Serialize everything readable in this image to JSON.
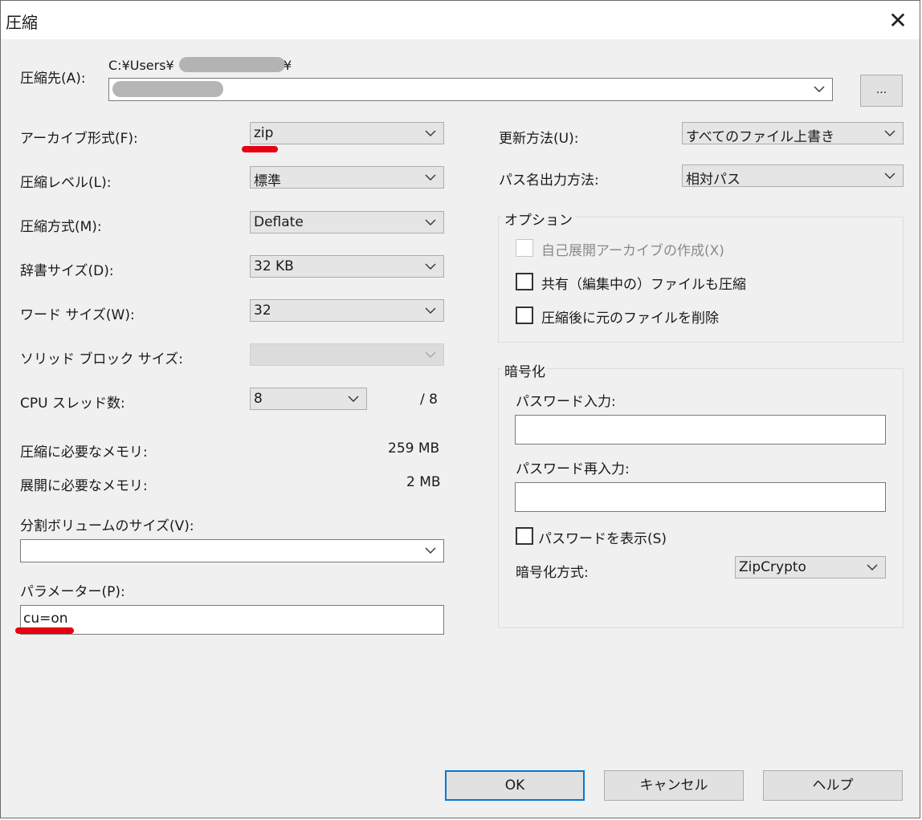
{
  "window": {
    "title": "圧縮",
    "close_glyph": "✕"
  },
  "destination": {
    "label": "圧縮先(A):",
    "path_prefix": "C:¥Users¥",
    "path_suffix": "¥",
    "browse_label": "..."
  },
  "left": {
    "archive_format": {
      "label": "アーカイブ形式(F):",
      "value": "zip"
    },
    "compression_level": {
      "label": "圧縮レベル(L):",
      "value": "標準"
    },
    "compression_method": {
      "label": "圧縮方式(M):",
      "value": "Deflate"
    },
    "dictionary_size": {
      "label": "辞書サイズ(D):",
      "value": "32 KB"
    },
    "word_size": {
      "label": "ワード サイズ(W):",
      "value": "32"
    },
    "solid_block_size": {
      "label": "ソリッド ブロック サイズ:",
      "value": ""
    },
    "cpu_threads": {
      "label": "CPU スレッド数:",
      "value": "8",
      "total": "/ 8"
    },
    "memory_compress": {
      "label": "圧縮に必要なメモリ:",
      "value": "259 MB"
    },
    "memory_decompress": {
      "label": "展開に必要なメモリ:",
      "value": "2 MB"
    },
    "split_volume": {
      "label": "分割ボリュームのサイズ(V):",
      "value": ""
    },
    "parameters": {
      "label": "パラメーター(P):",
      "value": "cu=on"
    }
  },
  "right": {
    "update_mode": {
      "label": "更新方法(U):",
      "value": "すべてのファイル上書き"
    },
    "path_mode": {
      "label": "パス名出力方法:",
      "value": "相対パス"
    },
    "options": {
      "title": "オプション",
      "sfx": "自己展開アーカイブの作成(X)",
      "shared": "共有（編集中の）ファイルも圧縮",
      "delete_after": "圧縮後に元のファイルを削除"
    },
    "encryption": {
      "title": "暗号化",
      "password_label": "パスワード入力:",
      "password_value": "",
      "reenter_label": "パスワード再入力:",
      "reenter_value": "",
      "show_password": "パスワードを表示(S)",
      "method_label": "暗号化方式:",
      "method_value": "ZipCrypto"
    }
  },
  "buttons": {
    "ok": "OK",
    "cancel": "キャンセル",
    "help": "ヘルプ"
  },
  "colors": {
    "annotation": "#e60012",
    "focus": "#0078d7",
    "dialog_bg": "#f0f0f0"
  }
}
